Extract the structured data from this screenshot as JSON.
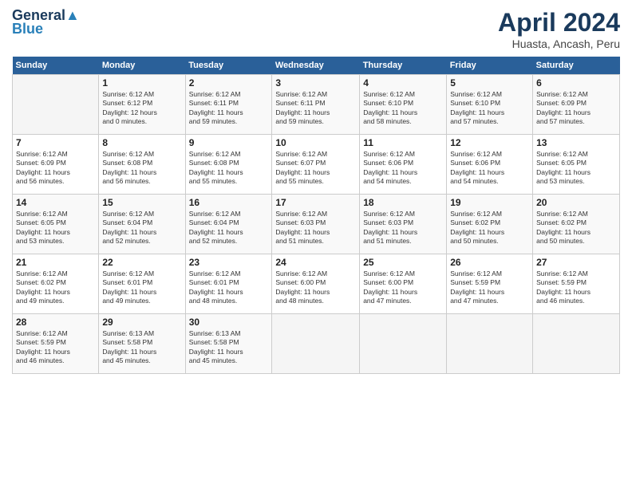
{
  "logo": {
    "line1": "General",
    "line2": "Blue"
  },
  "title": "April 2024",
  "subtitle": "Huasta, Ancash, Peru",
  "days_header": [
    "Sunday",
    "Monday",
    "Tuesday",
    "Wednesday",
    "Thursday",
    "Friday",
    "Saturday"
  ],
  "weeks": [
    [
      {
        "day": "",
        "info": ""
      },
      {
        "day": "1",
        "info": "Sunrise: 6:12 AM\nSunset: 6:12 PM\nDaylight: 12 hours\nand 0 minutes."
      },
      {
        "day": "2",
        "info": "Sunrise: 6:12 AM\nSunset: 6:11 PM\nDaylight: 11 hours\nand 59 minutes."
      },
      {
        "day": "3",
        "info": "Sunrise: 6:12 AM\nSunset: 6:11 PM\nDaylight: 11 hours\nand 59 minutes."
      },
      {
        "day": "4",
        "info": "Sunrise: 6:12 AM\nSunset: 6:10 PM\nDaylight: 11 hours\nand 58 minutes."
      },
      {
        "day": "5",
        "info": "Sunrise: 6:12 AM\nSunset: 6:10 PM\nDaylight: 11 hours\nand 57 minutes."
      },
      {
        "day": "6",
        "info": "Sunrise: 6:12 AM\nSunset: 6:09 PM\nDaylight: 11 hours\nand 57 minutes."
      }
    ],
    [
      {
        "day": "7",
        "info": "Sunrise: 6:12 AM\nSunset: 6:09 PM\nDaylight: 11 hours\nand 56 minutes."
      },
      {
        "day": "8",
        "info": "Sunrise: 6:12 AM\nSunset: 6:08 PM\nDaylight: 11 hours\nand 56 minutes."
      },
      {
        "day": "9",
        "info": "Sunrise: 6:12 AM\nSunset: 6:08 PM\nDaylight: 11 hours\nand 55 minutes."
      },
      {
        "day": "10",
        "info": "Sunrise: 6:12 AM\nSunset: 6:07 PM\nDaylight: 11 hours\nand 55 minutes."
      },
      {
        "day": "11",
        "info": "Sunrise: 6:12 AM\nSunset: 6:06 PM\nDaylight: 11 hours\nand 54 minutes."
      },
      {
        "day": "12",
        "info": "Sunrise: 6:12 AM\nSunset: 6:06 PM\nDaylight: 11 hours\nand 54 minutes."
      },
      {
        "day": "13",
        "info": "Sunrise: 6:12 AM\nSunset: 6:05 PM\nDaylight: 11 hours\nand 53 minutes."
      }
    ],
    [
      {
        "day": "14",
        "info": "Sunrise: 6:12 AM\nSunset: 6:05 PM\nDaylight: 11 hours\nand 53 minutes."
      },
      {
        "day": "15",
        "info": "Sunrise: 6:12 AM\nSunset: 6:04 PM\nDaylight: 11 hours\nand 52 minutes."
      },
      {
        "day": "16",
        "info": "Sunrise: 6:12 AM\nSunset: 6:04 PM\nDaylight: 11 hours\nand 52 minutes."
      },
      {
        "day": "17",
        "info": "Sunrise: 6:12 AM\nSunset: 6:03 PM\nDaylight: 11 hours\nand 51 minutes."
      },
      {
        "day": "18",
        "info": "Sunrise: 6:12 AM\nSunset: 6:03 PM\nDaylight: 11 hours\nand 51 minutes."
      },
      {
        "day": "19",
        "info": "Sunrise: 6:12 AM\nSunset: 6:02 PM\nDaylight: 11 hours\nand 50 minutes."
      },
      {
        "day": "20",
        "info": "Sunrise: 6:12 AM\nSunset: 6:02 PM\nDaylight: 11 hours\nand 50 minutes."
      }
    ],
    [
      {
        "day": "21",
        "info": "Sunrise: 6:12 AM\nSunset: 6:02 PM\nDaylight: 11 hours\nand 49 minutes."
      },
      {
        "day": "22",
        "info": "Sunrise: 6:12 AM\nSunset: 6:01 PM\nDaylight: 11 hours\nand 49 minutes."
      },
      {
        "day": "23",
        "info": "Sunrise: 6:12 AM\nSunset: 6:01 PM\nDaylight: 11 hours\nand 48 minutes."
      },
      {
        "day": "24",
        "info": "Sunrise: 6:12 AM\nSunset: 6:00 PM\nDaylight: 11 hours\nand 48 minutes."
      },
      {
        "day": "25",
        "info": "Sunrise: 6:12 AM\nSunset: 6:00 PM\nDaylight: 11 hours\nand 47 minutes."
      },
      {
        "day": "26",
        "info": "Sunrise: 6:12 AM\nSunset: 5:59 PM\nDaylight: 11 hours\nand 47 minutes."
      },
      {
        "day": "27",
        "info": "Sunrise: 6:12 AM\nSunset: 5:59 PM\nDaylight: 11 hours\nand 46 minutes."
      }
    ],
    [
      {
        "day": "28",
        "info": "Sunrise: 6:12 AM\nSunset: 5:59 PM\nDaylight: 11 hours\nand 46 minutes."
      },
      {
        "day": "29",
        "info": "Sunrise: 6:13 AM\nSunset: 5:58 PM\nDaylight: 11 hours\nand 45 minutes."
      },
      {
        "day": "30",
        "info": "Sunrise: 6:13 AM\nSunset: 5:58 PM\nDaylight: 11 hours\nand 45 minutes."
      },
      {
        "day": "",
        "info": ""
      },
      {
        "day": "",
        "info": ""
      },
      {
        "day": "",
        "info": ""
      },
      {
        "day": "",
        "info": ""
      }
    ]
  ]
}
